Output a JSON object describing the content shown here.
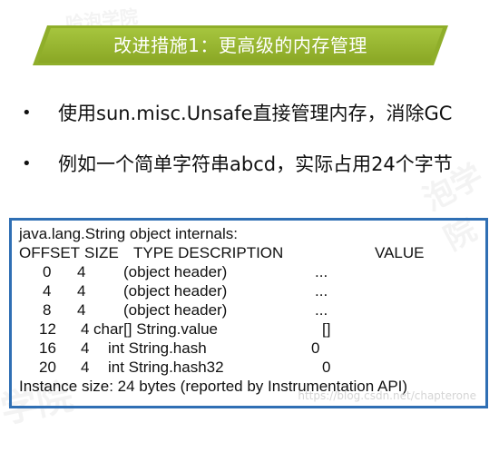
{
  "watermark": {
    "chars_top": "哈泡学院",
    "chars_mid": "泡学院",
    "chars_bottom": "学院",
    "url": "https://blog.csdn.net/chapterone"
  },
  "header": {
    "title": "改进措施1：更高级的内存管理",
    "color": "#8fae2a"
  },
  "bullets": [
    {
      "marker": "•",
      "text": "使用sun.misc.Unsafe直接管理内存，消除GC"
    },
    {
      "marker": "•",
      "text": "例如一个简单字符串abcd，实际占用24个字节"
    }
  ],
  "code": {
    "border_color": "#2f6fb4",
    "title": "java.lang.String object internals:",
    "headers": {
      "offset": "OFFSET",
      "size": "SIZE",
      "type_description": "TYPE DESCRIPTION",
      "value": "VALUE"
    },
    "rows": [
      {
        "offset": "0",
        "size": "4",
        "type": "(object header)",
        "value": "..."
      },
      {
        "offset": "4",
        "size": "4",
        "type": "(object header)",
        "value": "..."
      },
      {
        "offset": "8",
        "size": "4",
        "type": "(object header)",
        "value": "..."
      },
      {
        "offset": "12",
        "size": "4",
        "type": "char[] String.value",
        "value": "[]"
      },
      {
        "offset": "16",
        "size": "4",
        "type": "int String.hash",
        "value": "0"
      },
      {
        "offset": "20",
        "size": "4",
        "type": "int String.hash32",
        "value": "0"
      }
    ],
    "footer": "Instance size: 24 bytes (reported by Instrumentation API)"
  }
}
